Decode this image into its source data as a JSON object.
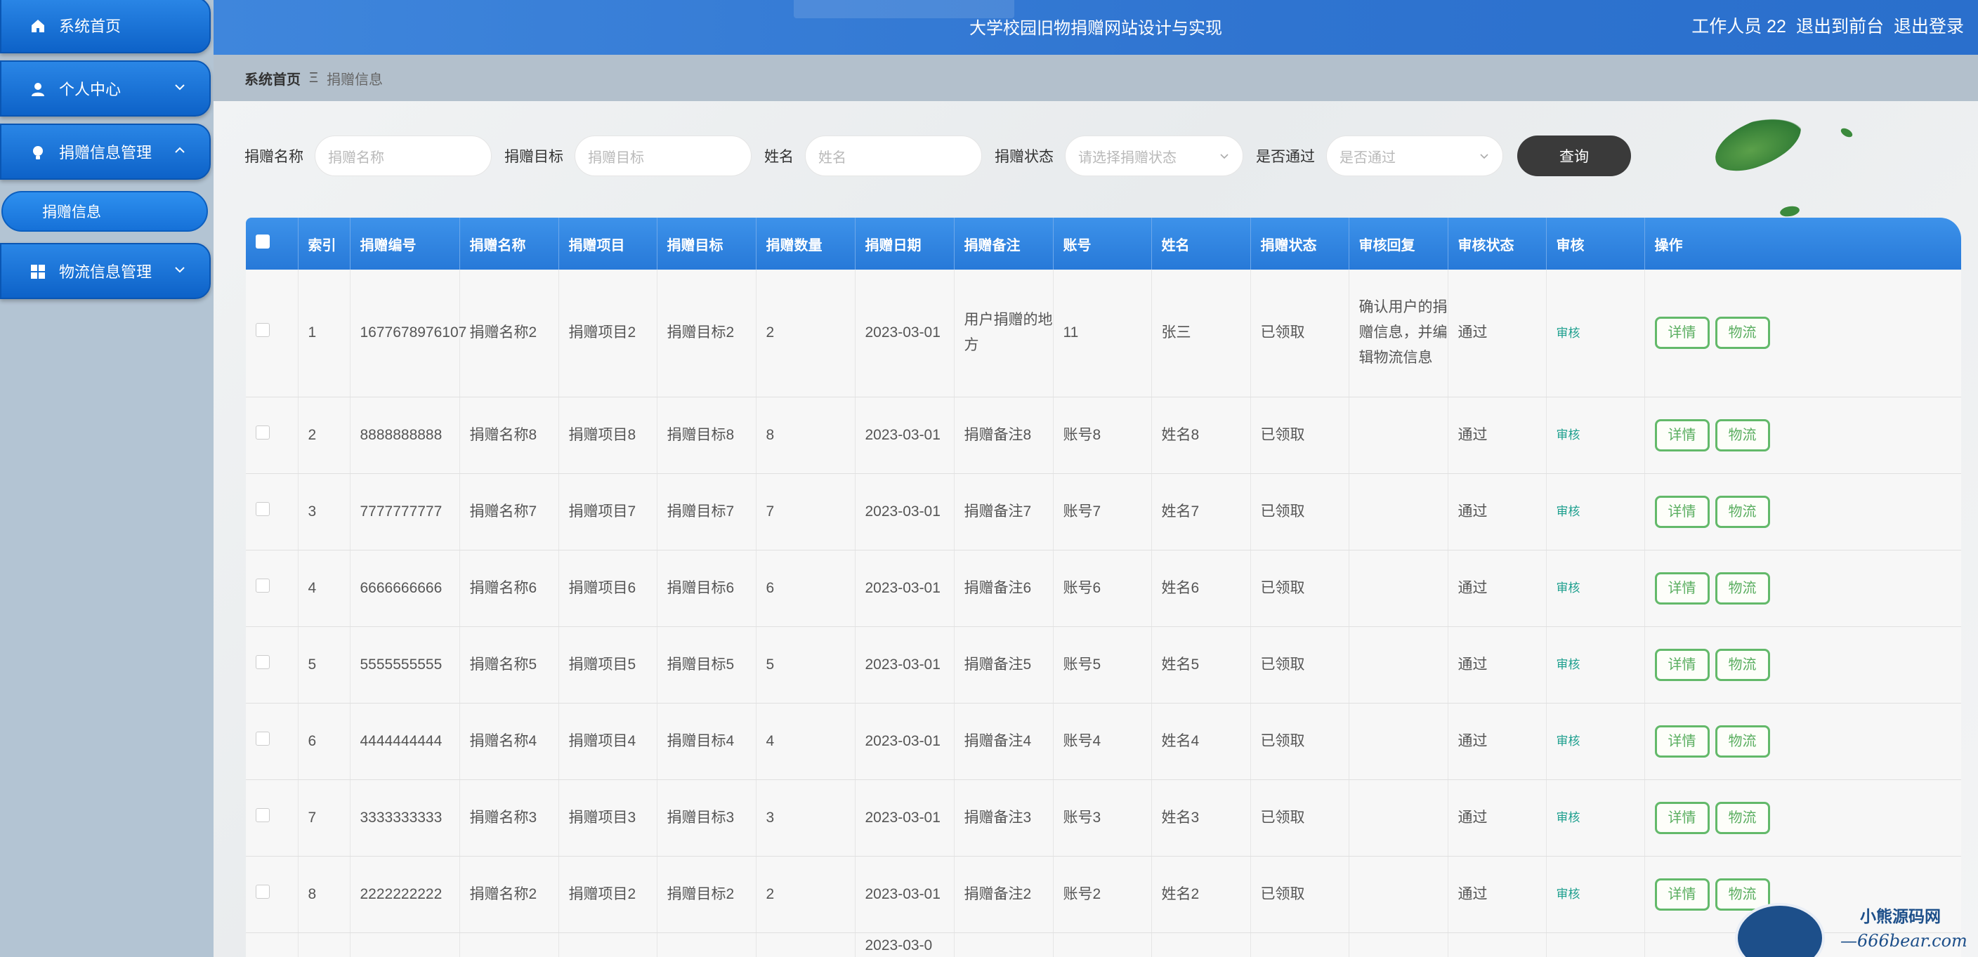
{
  "app": {
    "title": "大学校园旧物捐赠网站设计与实现",
    "user": "工作人员 22",
    "to_front": "退出到前台",
    "logout": "退出登录"
  },
  "sidebar": {
    "items": [
      {
        "label": "系统首页",
        "icon": "home-icon"
      },
      {
        "label": "个人中心",
        "icon": "user-icon"
      },
      {
        "label": "捐赠信息管理",
        "icon": "lightbulb-icon"
      },
      {
        "label": "物流信息管理",
        "icon": "grid-icon"
      }
    ],
    "sub_active": "捐赠信息"
  },
  "breadcrumb": {
    "home": "系统首页",
    "sep": "Ξ",
    "current": "捐赠信息"
  },
  "search": {
    "name_label": "捐赠名称",
    "name_placeholder": "捐赠名称",
    "target_label": "捐赠目标",
    "target_placeholder": "捐赠目标",
    "person_label": "姓名",
    "person_placeholder": "姓名",
    "status_label": "捐赠状态",
    "status_placeholder": "请选择捐赠状态",
    "pass_label": "是否通过",
    "pass_placeholder": "是否通过",
    "query_button": "查询"
  },
  "table": {
    "headers": [
      "索引",
      "捐赠编号",
      "捐赠名称",
      "捐赠项目",
      "捐赠目标",
      "捐赠数量",
      "捐赠日期",
      "捐赠备注",
      "账号",
      "姓名",
      "捐赠状态",
      "审核回复",
      "审核状态",
      "审核",
      "操作"
    ],
    "audit_label": "审核",
    "detail_label": "详情",
    "logistics_label": "物流",
    "rows": [
      {
        "idx": "1",
        "no": "1677678976107",
        "name": "捐赠名称2",
        "item": "捐赠项目2",
        "target": "捐赠目标2",
        "qty": "2",
        "date": "2023-03-01",
        "note": "用户捐赠的地方",
        "account": "11",
        "person": "张三",
        "status": "已领取",
        "reply": "确认用户的捐赠信息，并编辑物流信息",
        "audit_status": "通过"
      },
      {
        "idx": "2",
        "no": "8888888888",
        "name": "捐赠名称8",
        "item": "捐赠项目8",
        "target": "捐赠目标8",
        "qty": "8",
        "date": "2023-03-01",
        "note": "捐赠备注8",
        "account": "账号8",
        "person": "姓名8",
        "status": "已领取",
        "reply": "",
        "audit_status": "通过"
      },
      {
        "idx": "3",
        "no": "7777777777",
        "name": "捐赠名称7",
        "item": "捐赠项目7",
        "target": "捐赠目标7",
        "qty": "7",
        "date": "2023-03-01",
        "note": "捐赠备注7",
        "account": "账号7",
        "person": "姓名7",
        "status": "已领取",
        "reply": "",
        "audit_status": "通过"
      },
      {
        "idx": "4",
        "no": "6666666666",
        "name": "捐赠名称6",
        "item": "捐赠项目6",
        "target": "捐赠目标6",
        "qty": "6",
        "date": "2023-03-01",
        "note": "捐赠备注6",
        "account": "账号6",
        "person": "姓名6",
        "status": "已领取",
        "reply": "",
        "audit_status": "通过"
      },
      {
        "idx": "5",
        "no": "5555555555",
        "name": "捐赠名称5",
        "item": "捐赠项目5",
        "target": "捐赠目标5",
        "qty": "5",
        "date": "2023-03-01",
        "note": "捐赠备注5",
        "account": "账号5",
        "person": "姓名5",
        "status": "已领取",
        "reply": "",
        "audit_status": "通过"
      },
      {
        "idx": "6",
        "no": "4444444444",
        "name": "捐赠名称4",
        "item": "捐赠项目4",
        "target": "捐赠目标4",
        "qty": "4",
        "date": "2023-03-01",
        "note": "捐赠备注4",
        "account": "账号4",
        "person": "姓名4",
        "status": "已领取",
        "reply": "",
        "audit_status": "通过"
      },
      {
        "idx": "7",
        "no": "3333333333",
        "name": "捐赠名称3",
        "item": "捐赠项目3",
        "target": "捐赠目标3",
        "qty": "3",
        "date": "2023-03-01",
        "note": "捐赠备注3",
        "account": "账号3",
        "person": "姓名3",
        "status": "已领取",
        "reply": "",
        "audit_status": "通过"
      },
      {
        "idx": "8",
        "no": "2222222222",
        "name": "捐赠名称2",
        "item": "捐赠项目2",
        "target": "捐赠目标2",
        "qty": "2",
        "date": "2023-03-01",
        "note": "捐赠备注2",
        "account": "账号2",
        "person": "姓名2",
        "status": "已领取",
        "reply": "",
        "audit_status": "通过"
      }
    ],
    "partial_row": {
      "date": "2023-03-0"
    }
  },
  "watermark": {
    "line1": "小熊源码网",
    "line2": "—666bear.com—"
  }
}
